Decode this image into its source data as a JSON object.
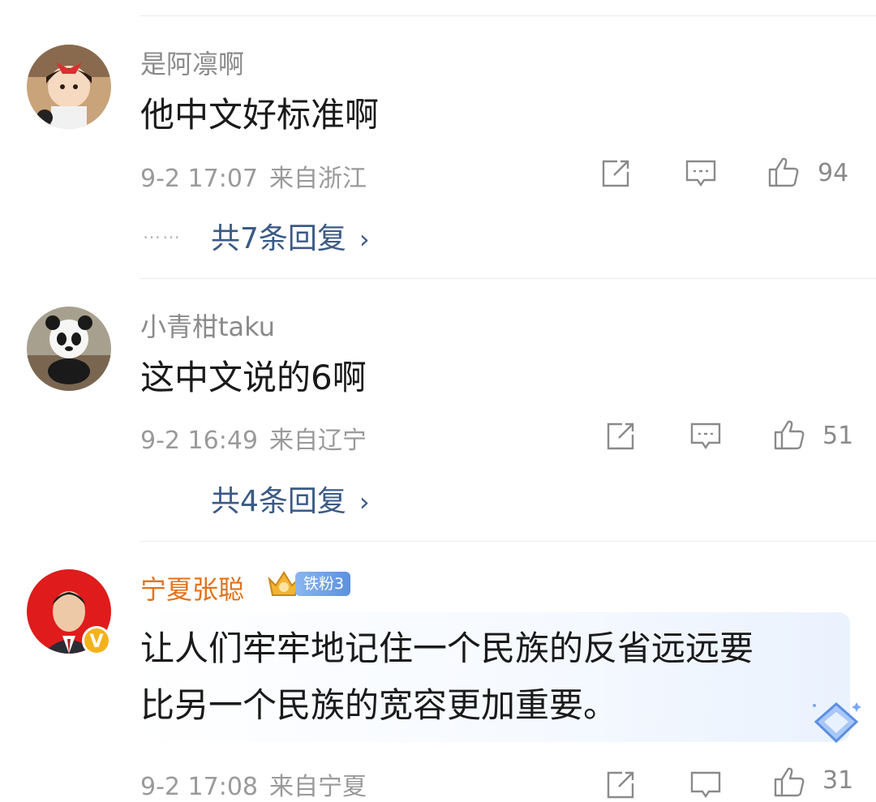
{
  "comments": [
    {
      "username": "是阿凛啊",
      "text": "他中文好标准啊",
      "date": "9-2 17:07",
      "location": "来自浙江",
      "likes": "94",
      "replies_label": "共7条回复",
      "replies_chevron": "›",
      "dots": "……"
    },
    {
      "username": "小青柑taku",
      "text": "这中文说的6啊",
      "date": "9-2 16:49",
      "location": "来自辽宁",
      "likes": "51",
      "replies_label": "共4条回复",
      "replies_chevron": "›"
    },
    {
      "username": "宁夏张聪",
      "fan_badge": "铁粉3",
      "verified_badge": "V",
      "text_line1": "让人们牢牢地记住一个民族的反省远远要",
      "text_line2": "比另一个民族的宽容更加重要。",
      "date": "9-2 17:08",
      "location": "来自宁夏",
      "likes": "31"
    }
  ],
  "icons": {
    "share": "share-icon",
    "comment": "comment-icon",
    "like": "thumbs-up-icon"
  },
  "colors": {
    "reply_link": "#3b5a86",
    "vip_name": "#e0731b",
    "meta_text": "#9a9a9a"
  }
}
